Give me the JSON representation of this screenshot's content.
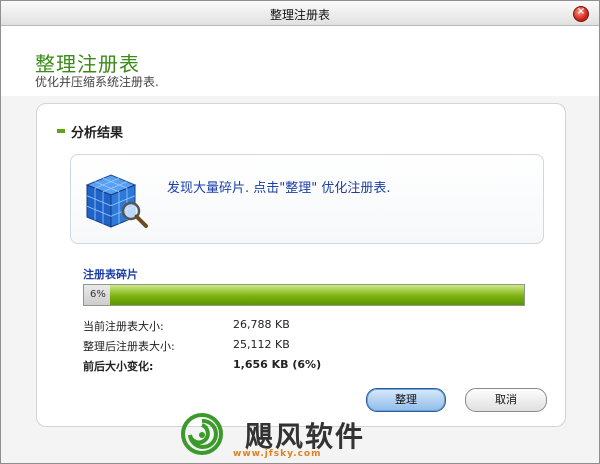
{
  "window": {
    "title": "整理注册表"
  },
  "header": {
    "title": "整理注册表",
    "subtitle": "优化并压缩系统注册表."
  },
  "section": {
    "title": "分析结果"
  },
  "info": {
    "message": "发现大量碎片. 点击\"整理\" 优化注册表.",
    "icon": "registry-cube-icon"
  },
  "progress": {
    "label": "注册表碎片",
    "percent_text": "6%",
    "value_percent": 6
  },
  "stats": [
    {
      "label": "当前注册表大小:",
      "value": "26,788 KB"
    },
    {
      "label": "整理后注册表大小:",
      "value": "25,112 KB"
    },
    {
      "label": "前后大小变化:",
      "value": "1,656 KB (6%)"
    }
  ],
  "buttons": {
    "primary": "整理",
    "cancel": "取消"
  },
  "watermark": {
    "text": "飓风软件",
    "url": "www.jfsky.com"
  },
  "colors": {
    "title_green": "#3a8b17",
    "info_blue": "#1b3fa6",
    "progress_green": "#7bb20f"
  }
}
